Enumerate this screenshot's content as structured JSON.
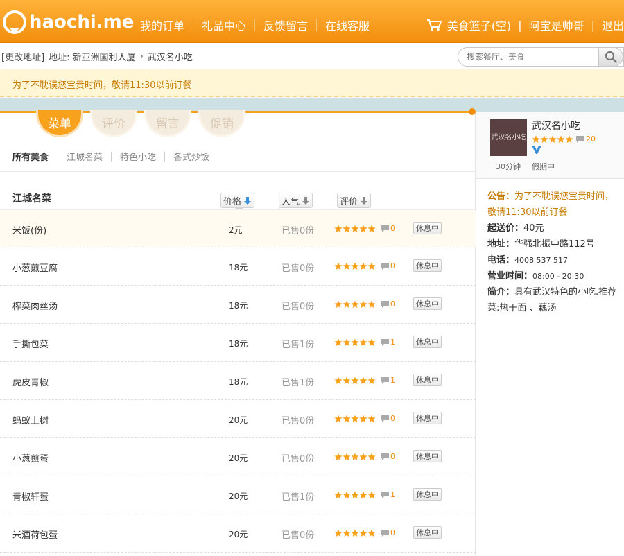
{
  "header": {
    "logo_text": "haochi.me",
    "nav": [
      "我的订单",
      "礼品中心",
      "反馈留言",
      "在线客服"
    ],
    "cart_label": "美食篮子(空)",
    "user_label": "阿宝是帅哥",
    "logout_label": "退出",
    "sep": "|"
  },
  "address": {
    "change_label": "[更改地址]",
    "prefix": "地址:",
    "building": "新亚洲国利人厦",
    "arrow": "›",
    "shop": "武汉名小吃"
  },
  "search": {
    "placeholder": "搜索餐厅、美食"
  },
  "notice": {
    "text": "为了不耽误您宝贵时间，敬请11:30以前订餐"
  },
  "tabs": [
    "菜单",
    "评价",
    "留言",
    "促销"
  ],
  "categories": {
    "all": "所有美食",
    "items": [
      "江城名菜",
      "特色小吃",
      "各式炒饭"
    ]
  },
  "section": {
    "title": "江城名菜",
    "sort_price": "价格",
    "sort_popularity": "人气",
    "sort_rating": "评价"
  },
  "dishes": [
    {
      "name": "米饭(份)",
      "price": "2元",
      "sold": "已售0份",
      "comments": "0",
      "status": "休息中"
    },
    {
      "name": "小葱煎豆腐",
      "price": "18元",
      "sold": "已售0份",
      "comments": "0",
      "status": "休息中"
    },
    {
      "name": "榨菜肉丝汤",
      "price": "18元",
      "sold": "已售0份",
      "comments": "0",
      "status": "休息中"
    },
    {
      "name": "手撕包菜",
      "price": "18元",
      "sold": "已售1份",
      "comments": "1",
      "status": "休息中"
    },
    {
      "name": "虎皮青椒",
      "price": "18元",
      "sold": "已售1份",
      "comments": "1",
      "status": "休息中"
    },
    {
      "name": "蚂蚁上树",
      "price": "20元",
      "sold": "已售0份",
      "comments": "0",
      "status": "休息中"
    },
    {
      "name": "小葱煎蛋",
      "price": "20元",
      "sold": "已售0份",
      "comments": "0",
      "status": "休息中"
    },
    {
      "name": "青椒轩蛋",
      "price": "20元",
      "sold": "已售1份",
      "comments": "1",
      "status": "休息中"
    },
    {
      "name": "米酒荷包蛋",
      "price": "20元",
      "sold": "已售0份",
      "comments": "0",
      "status": "休息中"
    }
  ],
  "shop": {
    "logo_text": "武汉名小吃",
    "name": "武汉名小吃",
    "review_count": "20",
    "delivery_time": "30分钟",
    "holiday": "假期中",
    "announcement_label": "公告：",
    "announcement": "为了不耽误您宝贵时间，敬请11:30以前订餐",
    "min_order_label": "起送价：",
    "min_order": "40元",
    "address_label": "地址：",
    "address": "华强北振中路112号",
    "phone_label": "电话：",
    "phone": "4008 537 517",
    "hours_label": "营业时间：",
    "hours": "08:00 - 20:30",
    "intro_label": "简介：",
    "intro": "具有武汉特色的小吃.推荐菜:热干面 、藕汤"
  },
  "colors": {
    "brand": "#f7a11c",
    "star": "#f7a11c",
    "notice_text": "#c77a00"
  }
}
